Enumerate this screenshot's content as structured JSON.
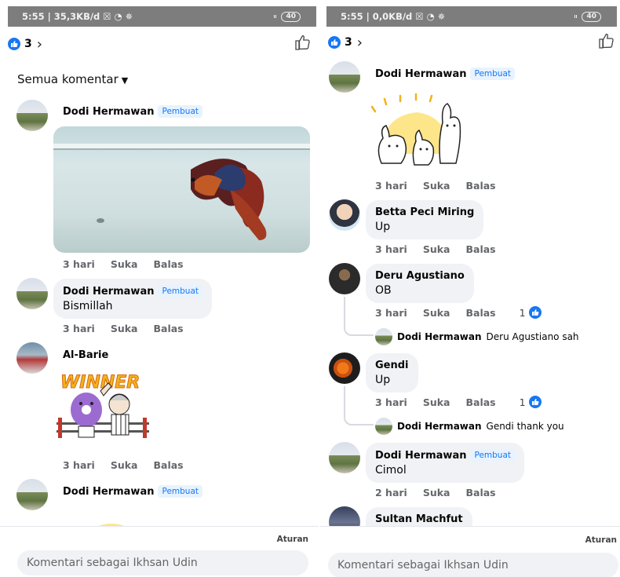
{
  "left": {
    "status": {
      "left": "5:55 | 35,3KB/d ☒ ◔ ✵",
      "signal": "ₗₗ",
      "battery": "40"
    },
    "header": {
      "like_count": "3"
    },
    "filter_label": "Semua komentar",
    "comments": [
      {
        "name": "Dodi Hermawan",
        "badge": "Pembuat",
        "time": "3 hari",
        "like": "Suka",
        "reply": "Balas"
      },
      {
        "name": "Dodi Hermawan",
        "badge": "Pembuat",
        "text": "Bismillah",
        "time": "3 hari",
        "like": "Suka",
        "reply": "Balas"
      },
      {
        "name": "Al-Barie",
        "time": "3 hari",
        "like": "Suka",
        "reply": "Balas"
      },
      {
        "name": "Dodi Hermawan",
        "badge": "Pembuat"
      }
    ],
    "sticker_text": "WINNER",
    "footer": {
      "aturan": "Aturan",
      "placeholder": "Komentari sebagai Ikhsan Udin"
    }
  },
  "right": {
    "status": {
      "left": "5:55 | 0,0KB/d ☒ ◔ ✵",
      "signal": "ₗₗ",
      "battery": "40"
    },
    "header": {
      "like_count": "3"
    },
    "comments": [
      {
        "name": "Dodi Hermawan",
        "badge": "Pembuat",
        "time": "3 hari",
        "like": "Suka",
        "reply": "Balas"
      },
      {
        "name": "Betta Peci Miring",
        "text": "Up",
        "time": "3 hari",
        "like": "Suka",
        "reply": "Balas"
      },
      {
        "name": "Deru Agustiano",
        "text": "OB",
        "time": "3 hari",
        "like": "Suka",
        "reply": "Balas",
        "reactions": "1"
      },
      {
        "name": "Gendi",
        "text": "Up",
        "time": "3 hari",
        "like": "Suka",
        "reply": "Balas",
        "reactions": "1"
      },
      {
        "name": "Dodi Hermawan",
        "badge": "Pembuat",
        "text": "Cimol",
        "time": "2 hari",
        "like": "Suka",
        "reply": "Balas"
      },
      {
        "name": "Sultan Machfut"
      }
    ],
    "replies": [
      {
        "name": "Dodi Hermawan",
        "text": "Deru Agustiano sah"
      },
      {
        "name": "Dodi Hermawan",
        "text": "Gendi thank you"
      }
    ],
    "footer": {
      "aturan": "Aturan",
      "placeholder": "Komentari sebagai Ikhsan Udin"
    }
  },
  "colors": {
    "accent": "#1877f2",
    "bubble": "#f0f2f5",
    "meta": "#65676b",
    "statusbar": "#7d7d7d"
  }
}
